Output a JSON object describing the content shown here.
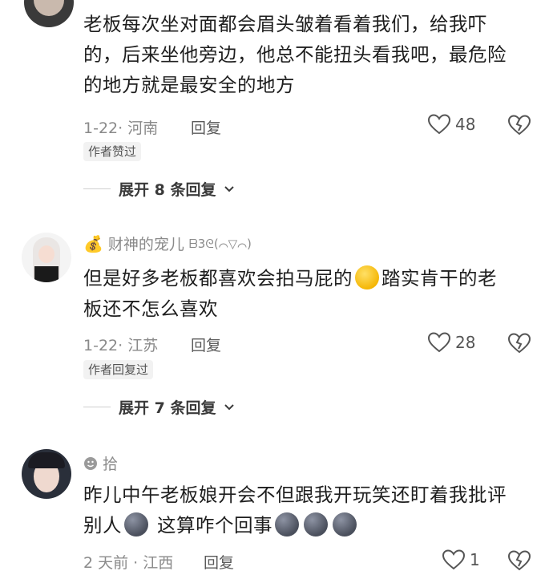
{
  "comments": [
    {
      "lines": [
        "老板每次坐对面都会眉头皱着看着我们，给我吓",
        "的，后来坐他旁边，他总不能扭头看我吧，最危险",
        "的地方就是最安全的地方"
      ],
      "date_location": "1-22· 河南",
      "reply_label": "回复",
      "likes": "48",
      "badge": "作者赞过",
      "expand": "展开 8 条回复"
    },
    {
      "username": "财神的宠儿",
      "username_suffix": "ᗷ3ᘓ(⌒▽⌒)",
      "line1_a": "但是好多老板都喜欢会拍马屁的",
      "line1_b": "踏实肯干的老",
      "line2": "板还不怎么喜欢",
      "date_location": "1-22· 江苏",
      "reply_label": "回复",
      "likes": "28",
      "badge": "作者回复过",
      "expand": "展开 7 条回复"
    },
    {
      "username": "拾",
      "line1": "昨儿中午老板娘开会不但跟我开玩笑还盯着我批评",
      "line2_a": "别人",
      "line2_b": "这算咋个回事",
      "date_location": "2 天前 · 江西",
      "reply_label": "回复",
      "likes": "1"
    }
  ],
  "icons": {
    "like": "heart-outline-icon",
    "dislike": "broken-heart-icon",
    "chevron": "chevron-down-icon",
    "moneybag": "money-bag-icon",
    "emoji_laugh": "laughing-crying-emoji",
    "emoji_moon": "dark-moon-face-emoji"
  }
}
